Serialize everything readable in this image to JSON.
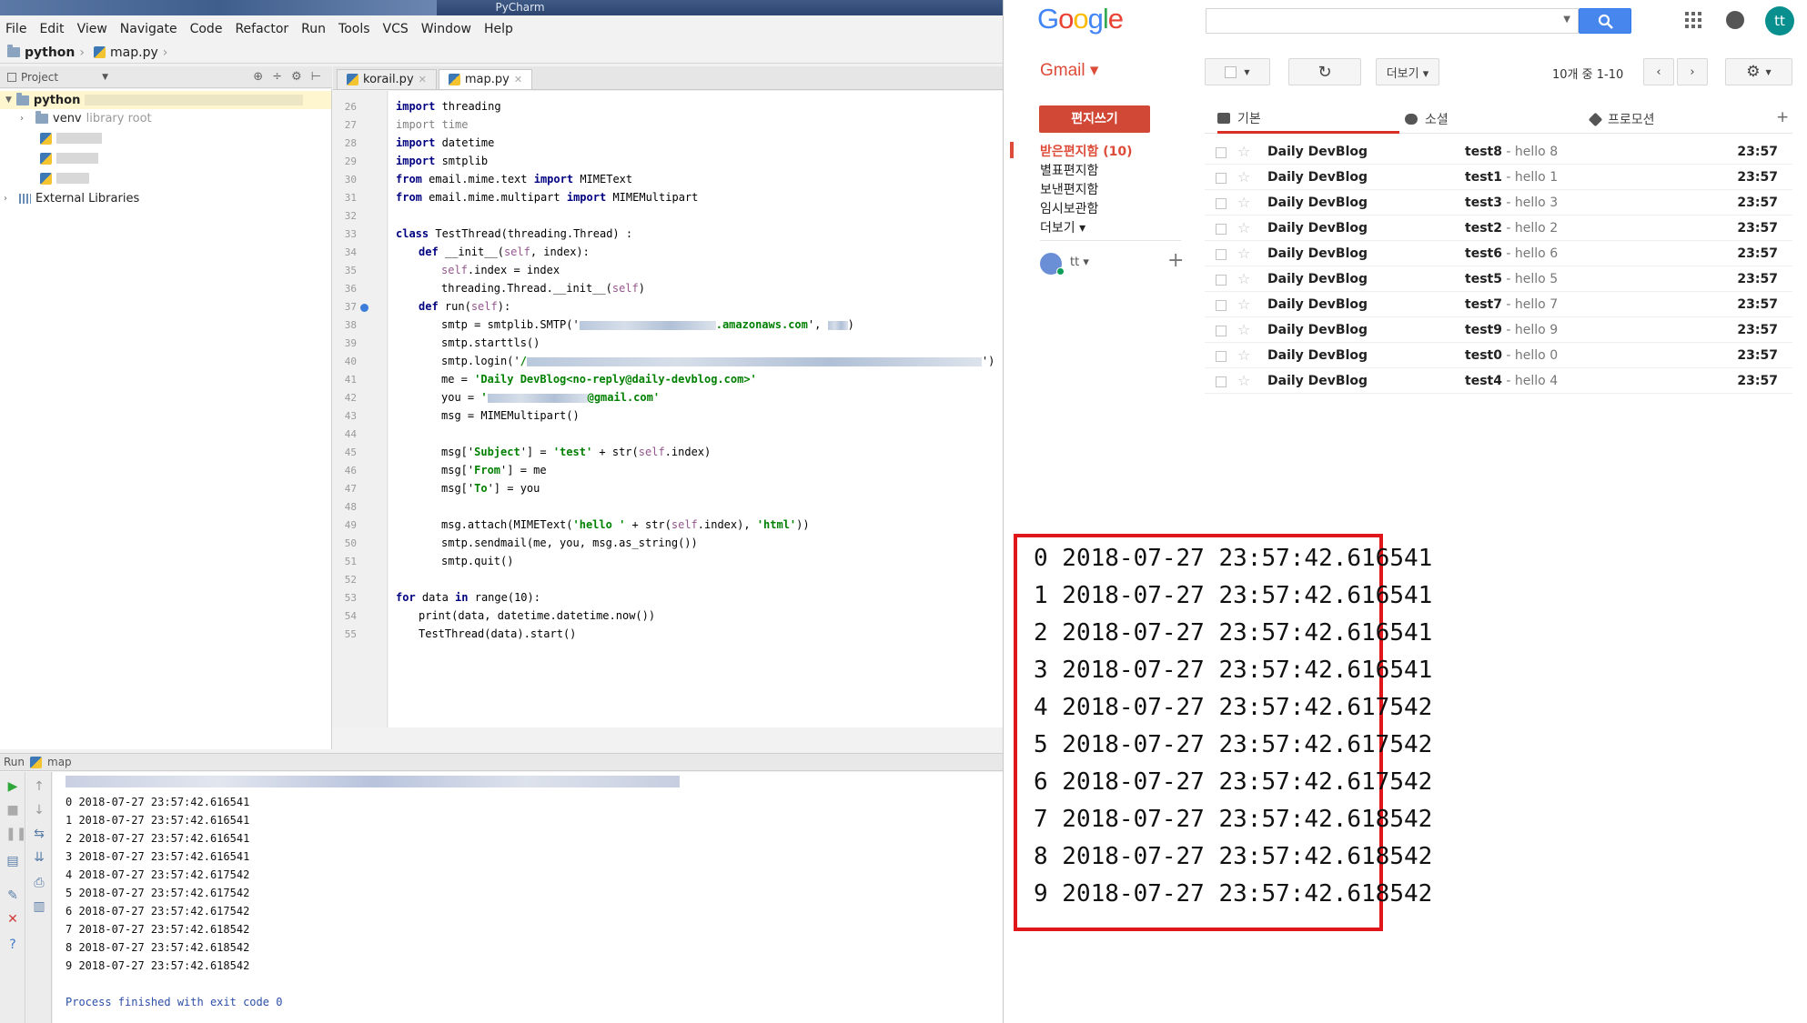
{
  "pycharm": {
    "title": "PyCharm",
    "menu": [
      "File",
      "Edit",
      "View",
      "Navigate",
      "Code",
      "Refactor",
      "Run",
      "Tools",
      "VCS",
      "Window",
      "Help"
    ],
    "breadcrumb": [
      "python",
      "map.py"
    ],
    "project_panel": {
      "label": "Project",
      "root": "python",
      "venv": "venv",
      "venv_note": "library root",
      "external": "External Libraries"
    },
    "tabs": [
      {
        "label": "korail.py",
        "active": false
      },
      {
        "label": "map.py",
        "active": true
      }
    ],
    "line_numbers": [
      "26",
      "27",
      "28",
      "29",
      "30",
      "31",
      "32",
      "33",
      "34",
      "35",
      "36",
      "37",
      "38",
      "39",
      "40",
      "41",
      "42",
      "43",
      "44",
      "45",
      "46",
      "47",
      "48",
      "49",
      "50",
      "51",
      "52",
      "53",
      "54",
      "55"
    ],
    "code": {
      "l26_kw": "import",
      "l26_rest": " threading",
      "l27_kw": "import",
      "l27_rest": " time",
      "l28_kw": "import",
      "l28_rest": " datetime",
      "l29_kw": "import",
      "l29_rest": " smtplib",
      "l30_kw1": "from",
      "l30_mid": " email.mime.text ",
      "l30_kw2": "import",
      "l30_rest": " MIMEText",
      "l31_kw1": "from",
      "l31_mid": " email.mime.multipart ",
      "l31_kw2": "import",
      "l31_rest": " MIMEMultipart",
      "l33_kw": "class",
      "l33_rest": " TestThread(threading.Thread) :",
      "l34_kw": "def",
      "l34_a": " __init__(",
      "l34_self": "self",
      "l34_b": ", index):",
      "l35_self": "self",
      "l35_rest": ".index = index",
      "l36": "threading.Thread.__init__(",
      "l36_self": "self",
      "l36_end": ")",
      "l37_kw": "def",
      "l37_a": " run(",
      "l37_self": "self",
      "l37_b": "):",
      "l38_a": "smtp = smtplib.SMTP('",
      "l38_str": ".amazonaws.com",
      "l38_b": "', ",
      "l38_end": ")",
      "l39": "smtp.starttls()",
      "l40_a": "smtp.login('",
      "l40_str": "/",
      "l40_end": "')",
      "l41_a": "me = ",
      "l41_str": "'Daily DevBlog<no-reply@daily-devblog.com>'",
      "l42_a": "you = ",
      "l42_str1": "'",
      "l42_str2": "@gmail.com'",
      "l43": "msg = MIMEMultipart()",
      "l45_a": "msg['",
      "l45_s1": "Subject",
      "l45_b": "'] = ",
      "l45_s2": "'test'",
      "l45_c": " + str(",
      "l45_self": "self",
      "l45_d": ".index)",
      "l46_a": "msg['",
      "l46_s1": "From",
      "l46_b": "'] = me",
      "l47_a": "msg['",
      "l47_s1": "To",
      "l47_b": "'] = you",
      "l49_a": "msg.attach(MIMEText(",
      "l49_s1": "'hello '",
      "l49_b": " + str(",
      "l49_self": "self",
      "l49_c": ".index), ",
      "l49_s2": "'html'",
      "l49_d": "))",
      "l50": "smtp.sendmail(me, you, msg.as_string())",
      "l51": "smtp.quit()",
      "l53_kw1": "for",
      "l53_a": " data ",
      "l53_kw2": "in",
      "l53_b": " range(10):",
      "l54": "print(data, datetime.datetime.now())",
      "l55": "TestThread(data).start()"
    },
    "run_panel": {
      "label": "Run",
      "config": "map",
      "output": [
        "0 2018-07-27 23:57:42.616541",
        "1 2018-07-27 23:57:42.616541",
        "2 2018-07-27 23:57:42.616541",
        "3 2018-07-27 23:57:42.616541",
        "4 2018-07-27 23:57:42.617542",
        "5 2018-07-27 23:57:42.617542",
        "6 2018-07-27 23:57:42.617542",
        "7 2018-07-27 23:57:42.618542",
        "8 2018-07-27 23:57:42.618542",
        "9 2018-07-27 23:57:42.618542"
      ],
      "exit": "Process finished with exit code 0"
    }
  },
  "gmail": {
    "logo": [
      "G",
      "o",
      "o",
      "g",
      "l",
      "e"
    ],
    "logo_colors": [
      "#4285f4",
      "#ea4335",
      "#fbbc05",
      "#4285f4",
      "#34a853",
      "#ea4335"
    ],
    "avatar": "tt",
    "product": "Gmail ▾",
    "more_button": "더보기 ▾",
    "pager": "10개 중 1-10",
    "compose": "편지쓰기",
    "nav": [
      "받은편지함 (10)",
      "별표편지함",
      "보낸편지함",
      "임시보관함",
      "더보기 ▾"
    ],
    "hangout_user": "tt ▾",
    "tabs": [
      "기본",
      "소셜",
      "프로모션"
    ],
    "emails": [
      {
        "sender": "Daily DevBlog",
        "subject": "test8",
        "snippet": " - hello 8",
        "time": "23:57"
      },
      {
        "sender": "Daily DevBlog",
        "subject": "test1",
        "snippet": " - hello 1",
        "time": "23:57"
      },
      {
        "sender": "Daily DevBlog",
        "subject": "test3",
        "snippet": " - hello 3",
        "time": "23:57"
      },
      {
        "sender": "Daily DevBlog",
        "subject": "test2",
        "snippet": " - hello 2",
        "time": "23:57"
      },
      {
        "sender": "Daily DevBlog",
        "subject": "test6",
        "snippet": " - hello 6",
        "time": "23:57"
      },
      {
        "sender": "Daily DevBlog",
        "subject": "test5",
        "snippet": " - hello 5",
        "time": "23:57"
      },
      {
        "sender": "Daily DevBlog",
        "subject": "test7",
        "snippet": " - hello 7",
        "time": "23:57"
      },
      {
        "sender": "Daily DevBlog",
        "subject": "test9",
        "snippet": " - hello 9",
        "time": "23:57"
      },
      {
        "sender": "Daily DevBlog",
        "subject": "test0",
        "snippet": " - hello 0",
        "time": "23:57"
      },
      {
        "sender": "Daily DevBlog",
        "subject": "test4",
        "snippet": " - hello 4",
        "time": "23:57"
      }
    ]
  },
  "zoomed_output": [
    "0 2018-07-27 23:57:42.616541",
    "1 2018-07-27 23:57:42.616541",
    "2 2018-07-27 23:57:42.616541",
    "3 2018-07-27 23:57:42.616541",
    "4 2018-07-27 23:57:42.617542",
    "5 2018-07-27 23:57:42.617542",
    "6 2018-07-27 23:57:42.617542",
    "7 2018-07-27 23:57:42.618542",
    "8 2018-07-27 23:57:42.618542",
    "9 2018-07-27 23:57:42.618542"
  ]
}
